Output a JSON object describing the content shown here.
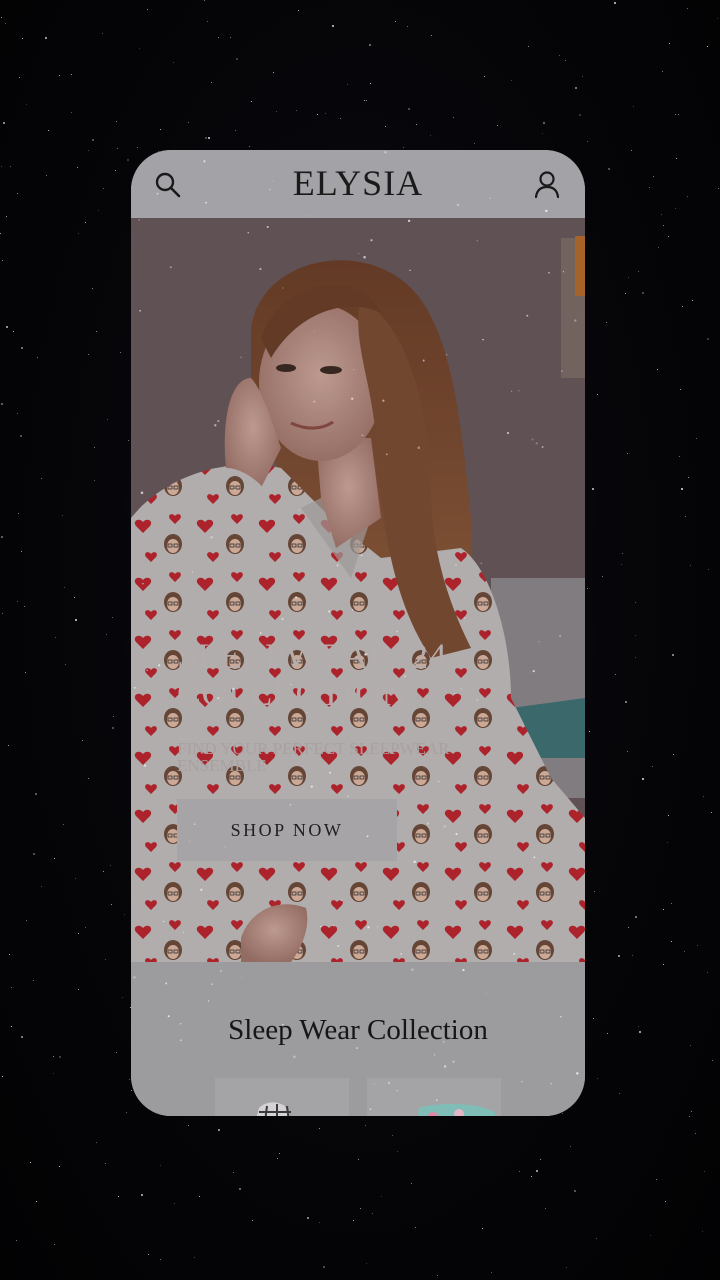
{
  "header": {
    "brand": "ELYSIA",
    "search_icon": "search-icon",
    "account_icon": "user-icon"
  },
  "hero": {
    "title_line1": "SLEEPWEAR '24",
    "title_line2": "COLLECTION",
    "subtitle_line1": "FIND YOUR PERFECT SLEEPWEAR",
    "subtitle_line2": "ENSEMBLE",
    "cta_label": "SHOP NOW"
  },
  "collection": {
    "title": "Sleep Wear Collection",
    "products": [
      {
        "image": "plaid-sleepwear-thumbnail"
      },
      {
        "image": "floral-sleepwear-thumbnail"
      }
    ]
  },
  "colors": {
    "background": "#030306",
    "card": "#9b9b9f",
    "heart": "#b8262e",
    "hero_text": "#b5adac"
  }
}
